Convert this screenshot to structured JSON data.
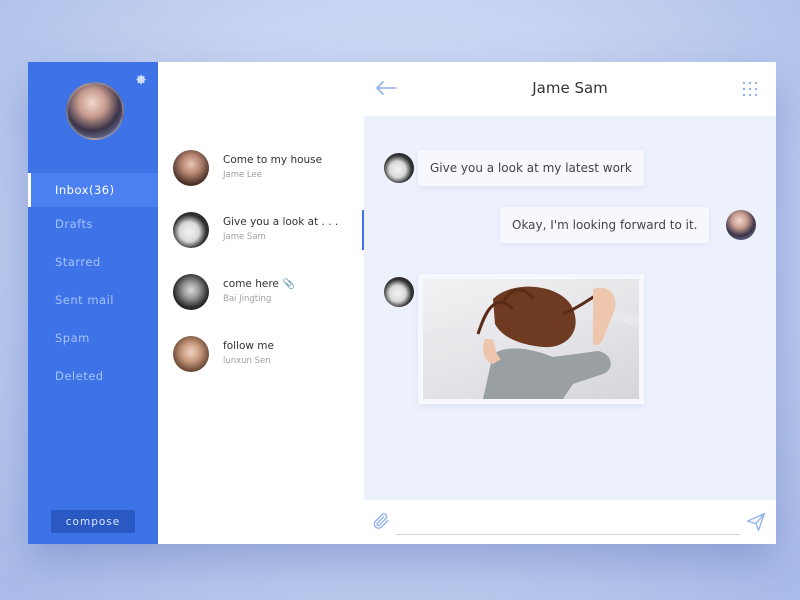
{
  "sidebar": {
    "items": [
      {
        "label": "Inbox(36)",
        "active": true
      },
      {
        "label": "Drafts"
      },
      {
        "label": "Starred"
      },
      {
        "label": "Sent mail"
      },
      {
        "label": "Spam"
      },
      {
        "label": "Deleted"
      }
    ],
    "compose_label": "compose"
  },
  "conversations": [
    {
      "title": "Come to my house",
      "sender": "Jame Lee"
    },
    {
      "title": "Give you a look at . . .",
      "sender": "Jame Sam",
      "active": true
    },
    {
      "title": "come here",
      "sender": "Bai Jingting",
      "has_attachment": true
    },
    {
      "title": "follow me",
      "sender": "lunxun Sen"
    }
  ],
  "chat": {
    "title": "Jame Sam",
    "messages": [
      {
        "from": "them",
        "text": "Give you a look at my latest work"
      },
      {
        "from": "me",
        "text": "Okay, I'm looking forward to it."
      },
      {
        "from": "them",
        "type": "image"
      }
    ],
    "input_value": ""
  },
  "colors": {
    "accent": "#3d73e6",
    "sidebar": "#3d73e6",
    "chat_bg": "#edf1fc"
  },
  "icons": [
    "gear-icon",
    "back-arrow-icon",
    "grid-menu-icon",
    "paperclip-icon",
    "send-icon"
  ]
}
